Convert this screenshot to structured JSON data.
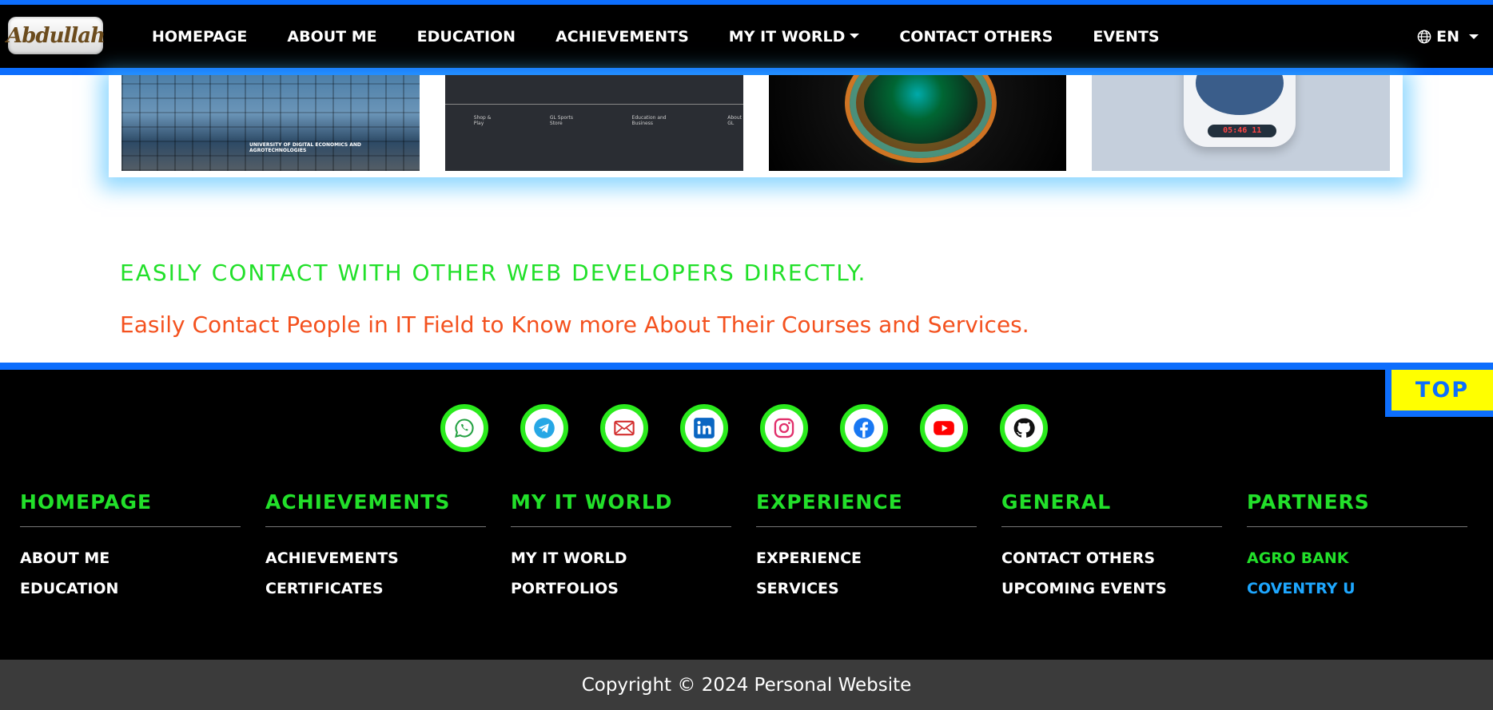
{
  "brand": {
    "logo_text": "Abdullah"
  },
  "nav": {
    "links": [
      "HOMEPAGE",
      "ABOUT ME",
      "EDUCATION",
      "ACHIEVEMENTS",
      "MY IT WORLD",
      "CONTACT OTHERS",
      "EVENTS"
    ],
    "lang": "EN"
  },
  "cards": {
    "img1_sign": "UNIVERSITY OF DIGITAL ECONOMICS AND AGROTECHNOLOGIES",
    "img2_cols": [
      "Shop & Play",
      "GL Sports Store",
      "Education and Business",
      "About GL"
    ],
    "img4_time": "05:46 11"
  },
  "section": {
    "headline": "EASILY CONTACT WITH OTHER WEB DEVELOPERS DIRECTLY.",
    "subline": "Easily Contact People in IT Field to Know more About Their Courses and Services."
  },
  "top_button": "TOP",
  "socials": [
    "whatsapp-icon",
    "telegram-icon",
    "mail-icon",
    "linkedin-icon",
    "instagram-icon",
    "facebook-icon",
    "youtube-icon",
    "github-icon"
  ],
  "footer": {
    "cols": [
      {
        "title": "HOMEPAGE",
        "links": [
          "ABOUT ME",
          "EDUCATION"
        ]
      },
      {
        "title": "ACHIEVEMENTS",
        "links": [
          "ACHIEVEMENTS",
          "CERTIFICATES"
        ]
      },
      {
        "title": "MY IT WORLD",
        "links": [
          "MY IT WORLD",
          "PORTFOLIOS"
        ]
      },
      {
        "title": "EXPERIENCE",
        "links": [
          "EXPERIENCE",
          "SERVICES"
        ]
      },
      {
        "title": "GENERAL",
        "links": [
          "CONTACT OTHERS",
          "UPCOMING EVENTS"
        ]
      },
      {
        "title": "PARTNERS",
        "links": [
          "AGRO BANK",
          "COVENTRY U"
        ]
      }
    ],
    "copyright": "Copyright © 2024 Personal Website"
  },
  "colors": {
    "accent_blue": "#0d6efd",
    "green": "#22e02a",
    "orange": "#f4511e",
    "top_yellow": "#ffff00"
  }
}
